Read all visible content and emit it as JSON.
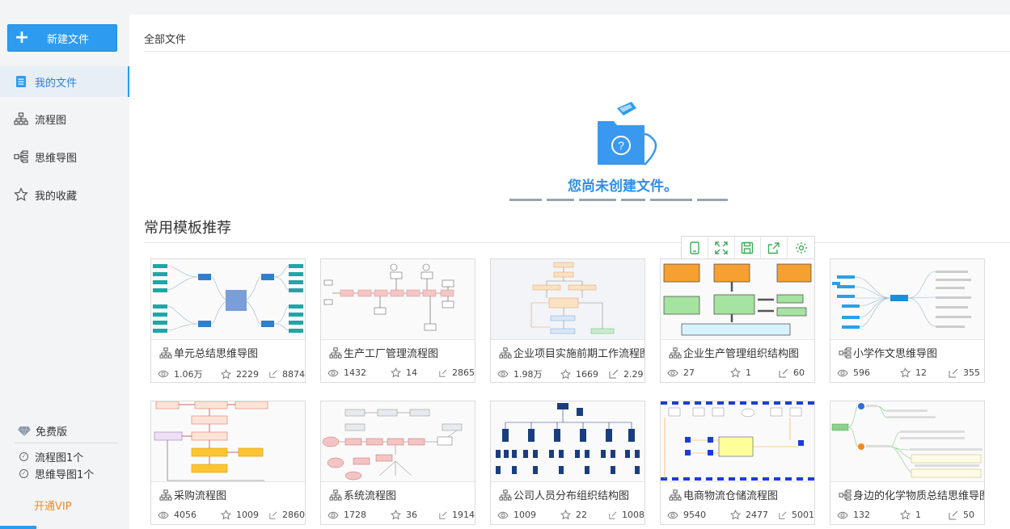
{
  "sidebar": {
    "new_button": "新建文件",
    "items": [
      {
        "label": "我的文件"
      },
      {
        "label": "流程图"
      },
      {
        "label": "思维导图"
      },
      {
        "label": "我的收藏"
      }
    ],
    "plan_label": "免费版",
    "stats": [
      {
        "label": "流程图1个"
      },
      {
        "label": "思维导图1个"
      }
    ],
    "vip_label": "开通VIP"
  },
  "main": {
    "breadcrumb": "全部文件",
    "empty_text": "您尚未创建文件。",
    "recommend_title": "常用模板推荐",
    "templates": [
      {
        "name": "单元总结思维导图",
        "views": "1.06万",
        "stars": "2229",
        "edits": "8874",
        "thumb": "mind-teal"
      },
      {
        "name": "生产工厂管理流程图",
        "views": "1432",
        "stars": "14",
        "edits": "2865",
        "thumb": "flow-pink"
      },
      {
        "name": "企业项目实施前期工作流程图",
        "views": "1.98万",
        "stars": "1669",
        "edits": "2.29",
        "thumb": "flow-orange"
      },
      {
        "name": "企业生产管理组织结构图",
        "views": "27",
        "stars": "1",
        "edits": "60",
        "thumb": "org-green"
      },
      {
        "name": "小学作文思维导图",
        "views": "596",
        "stars": "12",
        "edits": "355",
        "thumb": "mind-blue"
      },
      {
        "name": "采购流程图",
        "views": "4056",
        "stars": "1009",
        "edits": "2860",
        "thumb": "flow-purchase"
      },
      {
        "name": "系统流程图",
        "views": "1728",
        "stars": "36",
        "edits": "1914",
        "thumb": "flow-system"
      },
      {
        "name": "公司人员分布组织结构图",
        "views": "1009",
        "stars": "22",
        "edits": "1008",
        "thumb": "org-navy"
      },
      {
        "name": "电商物流仓储流程图",
        "views": "9540",
        "stars": "2477",
        "edits": "5001",
        "thumb": "flow-warehouse"
      },
      {
        "name": "身边的化学物质总结思维导图",
        "views": "132",
        "stars": "1",
        "edits": "50",
        "thumb": "mind-green"
      }
    ]
  },
  "toolbar": {
    "icons": [
      "mobile-icon",
      "fullscreen-icon",
      "save-icon",
      "share-icon",
      "settings-icon"
    ]
  },
  "colors": {
    "accent": "#2d9cf0",
    "vip": "#f08a1c",
    "empty_text": "#2d8fe8"
  }
}
